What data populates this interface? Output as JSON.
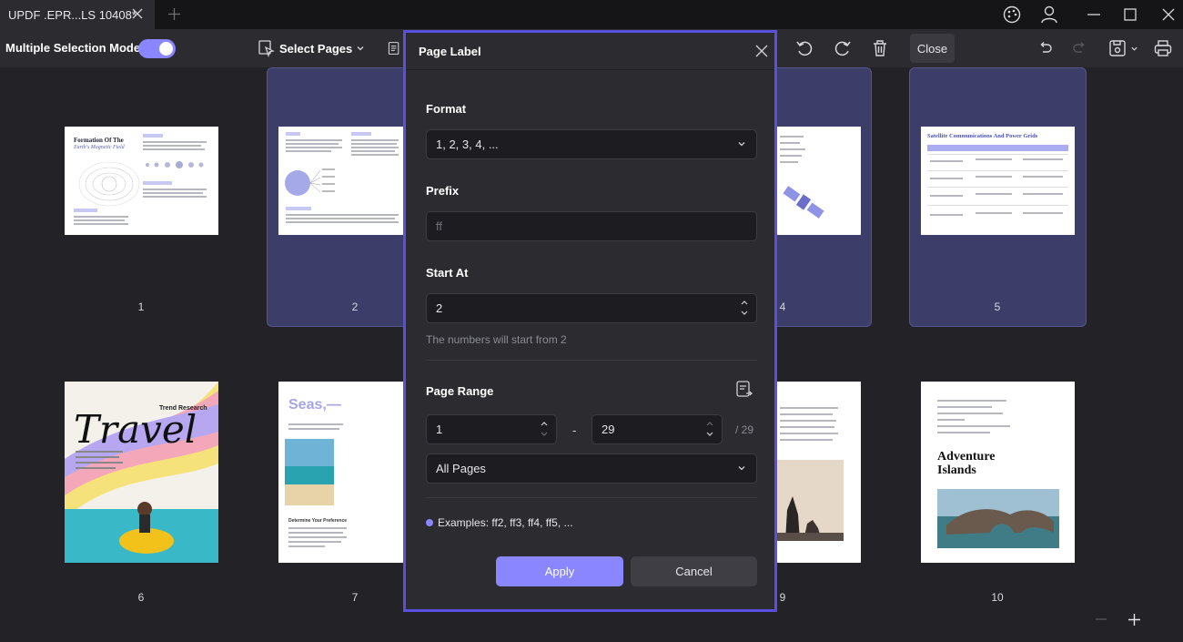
{
  "titlebar": {
    "tab_title": "UPDF .EPR...LS 10408*",
    "icons": [
      "close-icon",
      "plus-icon",
      "palette-icon",
      "user-icon",
      "minimize-icon",
      "maximize-icon",
      "window-close-icon"
    ]
  },
  "toolbar": {
    "multiple_selection_label": "Multiple Selection Mode",
    "multiple_selection_on": true,
    "select_pages_label": "Select Pages",
    "close_label": "Close"
  },
  "pages": [
    {
      "num": "1",
      "title": "Formation Of The",
      "subtitle": "Earth's Magnetic Field"
    },
    {
      "num": "2"
    },
    {
      "num": "4"
    },
    {
      "num": "5",
      "title": "Satellite Communications And Power Grids"
    },
    {
      "num": "6",
      "small": "Trend Research",
      "title": "Travel"
    },
    {
      "num": "7",
      "title": "Seas,—",
      "caption": "Determine Your Preference"
    },
    {
      "num": "9"
    },
    {
      "num": "10",
      "title": "Adventure Islands"
    }
  ],
  "dialog": {
    "title": "Page Label",
    "format_label": "Format",
    "format_value": "1, 2, 3, 4, ...",
    "prefix_label": "Prefix",
    "prefix_value": "ff",
    "start_label": "Start At",
    "start_value": "2",
    "start_hint": "The numbers will start from 2",
    "range_label": "Page Range",
    "range_from": "1",
    "range_dash": "-",
    "range_to": "29",
    "range_of": "/ 29",
    "range_subset": "All Pages",
    "examples": "Examples: ff2, ff3, ff4, ff5, ...",
    "apply_label": "Apply",
    "cancel_label": "Cancel"
  },
  "colors": {
    "accent": "#8a86ff",
    "dialog_border": "#5b4fe0",
    "selection_bg": "#3c3d68"
  }
}
